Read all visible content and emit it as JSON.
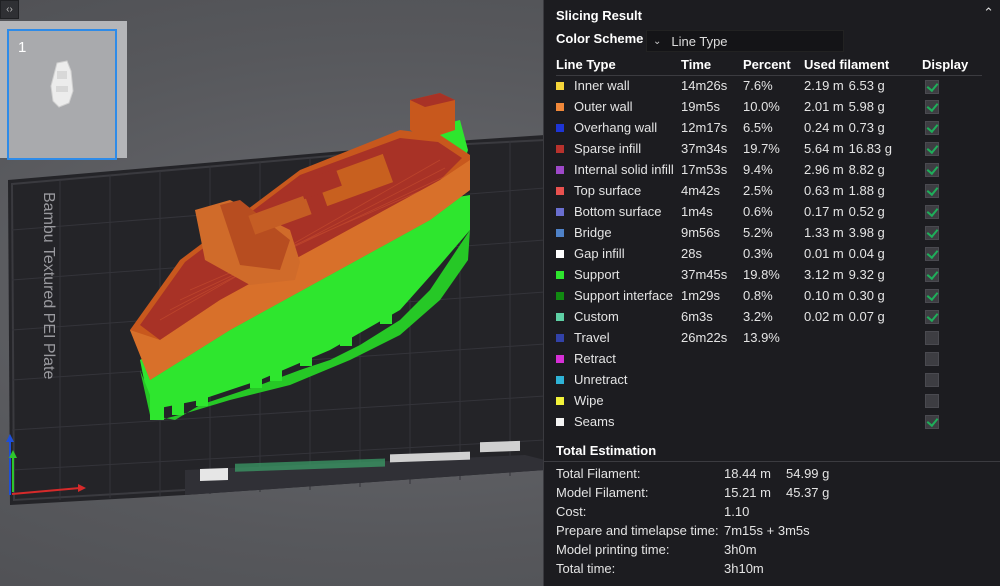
{
  "viewport": {
    "plate_label": "Bambu Textured PEI Plate",
    "plate_number": "1",
    "expand_icon": "code-brackets-icon"
  },
  "panel": {
    "title": "Slicing Result",
    "color_scheme_label": "Color Scheme",
    "color_scheme_value": "Line Type",
    "columns": [
      "Line Type",
      "Time",
      "Percent",
      "Used filament",
      "Display"
    ],
    "rows": [
      {
        "type": "Inner wall",
        "color": "#f5d53a",
        "time": "14m26s",
        "percent": "7.6%",
        "length": "2.19 m",
        "weight": "6.53 g",
        "shown": true
      },
      {
        "type": "Outer wall",
        "color": "#f0883a",
        "time": "19m5s",
        "percent": "10.0%",
        "length": "2.01 m",
        "weight": "5.98 g",
        "shown": true
      },
      {
        "type": "Overhang wall",
        "color": "#1e35d6",
        "time": "12m17s",
        "percent": "6.5%",
        "length": "0.24 m",
        "weight": "0.73 g",
        "shown": true
      },
      {
        "type": "Sparse infill",
        "color": "#b8322d",
        "time": "37m34s",
        "percent": "19.7%",
        "length": "5.64 m",
        "weight": "16.83 g",
        "shown": true
      },
      {
        "type": "Internal solid infill",
        "color": "#9e48c8",
        "time": "17m53s",
        "percent": "9.4%",
        "length": "2.96 m",
        "weight": "8.82 g",
        "shown": true
      },
      {
        "type": "Top surface",
        "color": "#e8514f",
        "time": "4m42s",
        "percent": "2.5%",
        "length": "0.63 m",
        "weight": "1.88 g",
        "shown": true
      },
      {
        "type": "Bottom surface",
        "color": "#6a6fd0",
        "time": "1m4s",
        "percent": "0.6%",
        "length": "0.17 m",
        "weight": "0.52 g",
        "shown": true
      },
      {
        "type": "Bridge",
        "color": "#4f82c8",
        "time": "9m56s",
        "percent": "5.2%",
        "length": "1.33 m",
        "weight": "3.98 g",
        "shown": true
      },
      {
        "type": "Gap infill",
        "color": "#ffffff",
        "time": "28s",
        "percent": "0.3%",
        "length": "0.01 m",
        "weight": "0.04 g",
        "shown": true
      },
      {
        "type": "Support",
        "color": "#2ee62e",
        "time": "37m45s",
        "percent": "19.8%",
        "length": "3.12 m",
        "weight": "9.32 g",
        "shown": true
      },
      {
        "type": "Support interface",
        "color": "#118a11",
        "time": "1m29s",
        "percent": "0.8%",
        "length": "0.10 m",
        "weight": "0.30 g",
        "shown": true
      },
      {
        "type": "Custom",
        "color": "#5ed0a5",
        "time": "6m3s",
        "percent": "3.2%",
        "length": "0.02 m",
        "weight": "0.07 g",
        "shown": true
      },
      {
        "type": "Travel",
        "color": "#3242a8",
        "time": "26m22s",
        "percent": "13.9%",
        "length": "",
        "weight": "",
        "shown": false
      },
      {
        "type": "Retract",
        "color": "#d62fd6",
        "time": "",
        "percent": "",
        "length": "",
        "weight": "",
        "shown": false
      },
      {
        "type": "Unretract",
        "color": "#2fb3d6",
        "time": "",
        "percent": "",
        "length": "",
        "weight": "",
        "shown": false
      },
      {
        "type": "Wipe",
        "color": "#f2f23a",
        "time": "",
        "percent": "",
        "length": "",
        "weight": "",
        "shown": false
      },
      {
        "type": "Seams",
        "color": "#f4f4f4",
        "time": "",
        "percent": "",
        "length": "",
        "weight": "",
        "shown": true
      }
    ],
    "total_title": "Total Estimation",
    "estimation": [
      {
        "label": "Total Filament:",
        "v1": "18.44 m",
        "v2": "54.99 g"
      },
      {
        "label": "Model Filament:",
        "v1": "15.21 m",
        "v2": "45.37 g"
      },
      {
        "label": "Cost:",
        "v1": "1.10",
        "v2": ""
      },
      {
        "label": "Prepare and timelapse time:",
        "v1": "7m15s + 3m5s",
        "v2": ""
      },
      {
        "label": "Model printing time:",
        "v1": "3h0m",
        "v2": ""
      },
      {
        "label": "Total time:",
        "v1": "3h10m",
        "v2": ""
      }
    ]
  }
}
